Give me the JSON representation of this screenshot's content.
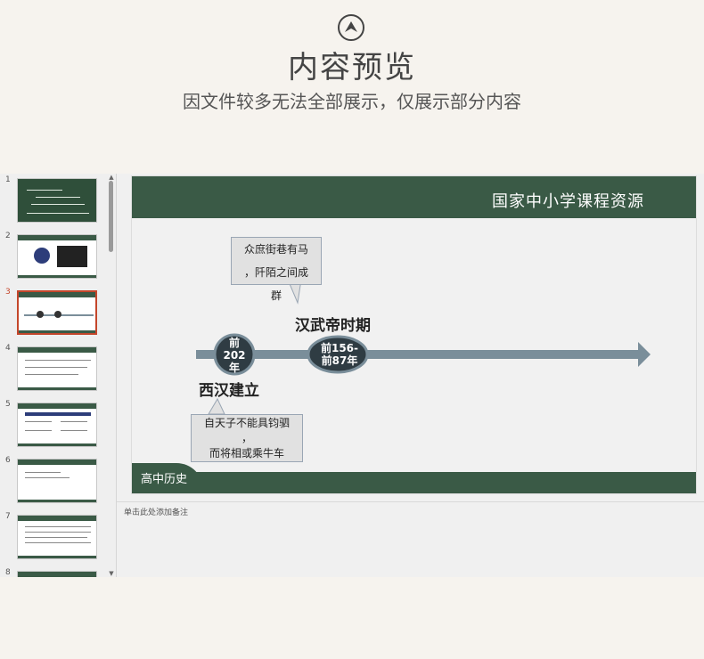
{
  "header": {
    "icon": "up-chevron-circle-icon",
    "title": "内容预览",
    "subtitle": "因文件较多无法全部展示，仅展示部分内容"
  },
  "thumbnails": [
    {
      "num": "1",
      "active": false
    },
    {
      "num": "2",
      "active": false
    },
    {
      "num": "3",
      "active": true
    },
    {
      "num": "4",
      "active": false
    },
    {
      "num": "5",
      "active": false
    },
    {
      "num": "6",
      "active": false
    },
    {
      "num": "7",
      "active": false
    },
    {
      "num": "8",
      "active": false
    }
  ],
  "slide": {
    "brand": "国家中小学课程资源",
    "course": "高中历史",
    "callout_top": [
      "众庶街巷有马",
      "，阡陌之间成",
      "群"
    ],
    "callout_bottom": [
      "自天子不能具钧驷",
      "，",
      "而将相或乘牛车"
    ],
    "label_a": "汉武帝时期",
    "label_b": "西汉建立",
    "node_1": [
      "前",
      "202",
      "年"
    ],
    "node_2": [
      "前156-",
      "前87年"
    ]
  },
  "notes": {
    "placeholder": "单击此处添加备注"
  },
  "colors": {
    "accent_green": "#3a5a46",
    "timeline": "#7a8e9a",
    "active_border": "#c4462b"
  }
}
